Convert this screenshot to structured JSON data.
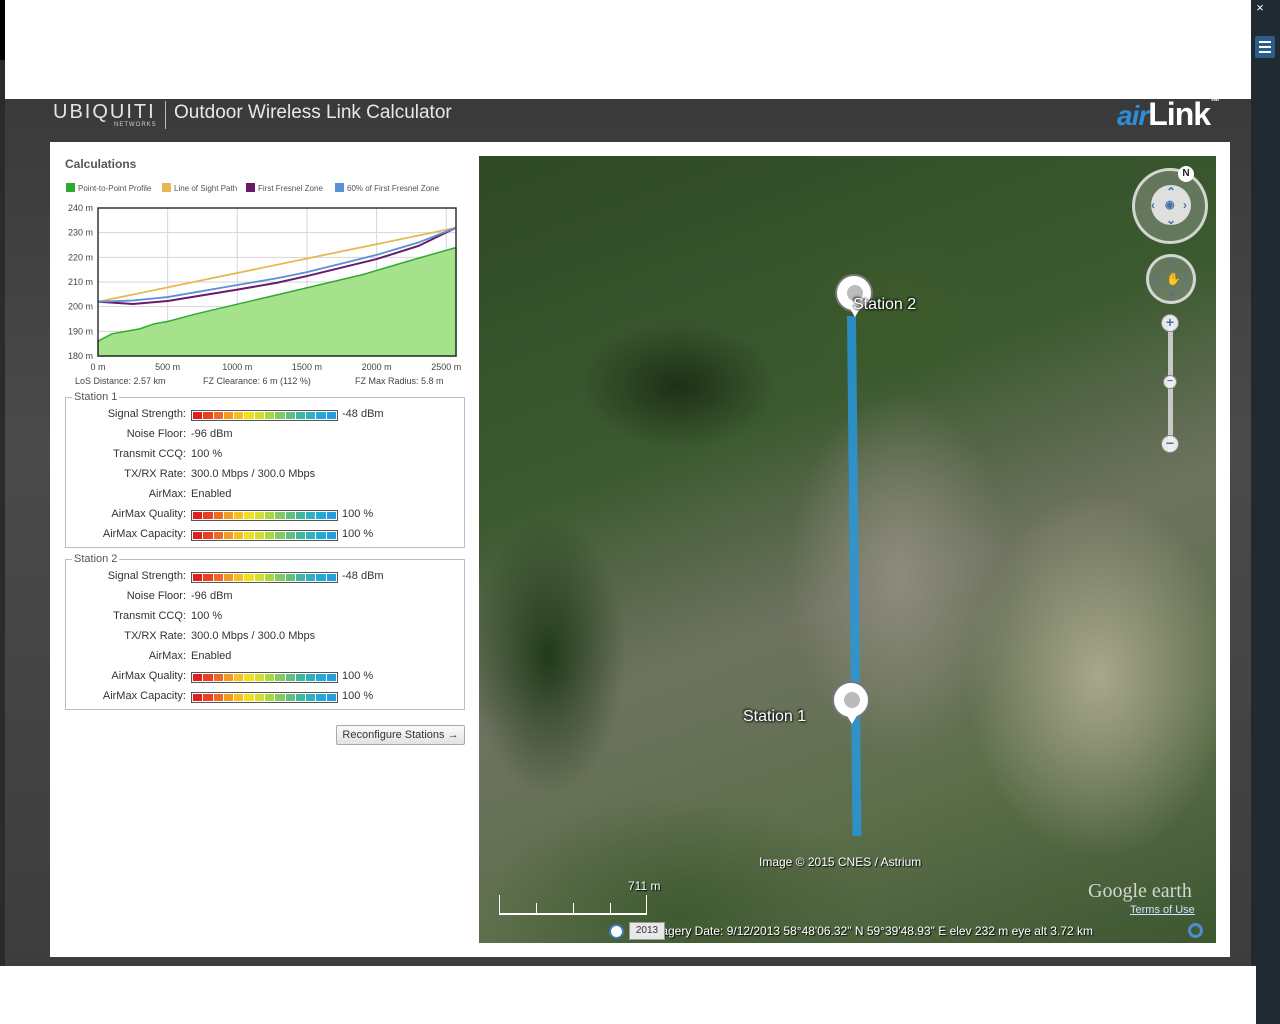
{
  "header": {
    "brand": "UBIQUITI",
    "brand_sub": "NETWORKS",
    "title": "Outdoor Wireless Link Calculator",
    "product_logo_air": "air",
    "product_logo_link": "Link",
    "product_logo_tm": "TM"
  },
  "window": {
    "close_label": "×"
  },
  "calculations": {
    "title": "Calculations",
    "legend": [
      {
        "label": "Point-to-Point Profile",
        "color": "#2eab2e"
      },
      {
        "label": "Line of Sight Path",
        "color": "#e6b84f"
      },
      {
        "label": "First Fresnel Zone",
        "color": "#6b1a6b"
      },
      {
        "label": "60% of First Fresnel Zone",
        "color": "#5b8fd6"
      }
    ],
    "summary": {
      "los_distance": "LoS Distance: 2.57 km",
      "fz_clearance": "FZ Clearance: 6 m  (112 %)",
      "fz_max_radius": "FZ Max Radius: 5.8 m"
    }
  },
  "chart_data": {
    "type": "area",
    "title": "",
    "xlabel": "",
    "ylabel": "",
    "xlim": [
      0,
      2570
    ],
    "ylim": [
      180,
      240
    ],
    "x_ticks": [
      "0 m",
      "500 m",
      "1000 m",
      "1500 m",
      "2000 m",
      "2500 m"
    ],
    "x_tick_values": [
      0,
      500,
      1000,
      1500,
      2000,
      2500
    ],
    "y_ticks": [
      "180 m",
      "190 m",
      "200 m",
      "210 m",
      "220 m",
      "230 m",
      "240 m"
    ],
    "y_tick_values": [
      180,
      190,
      200,
      210,
      220,
      230,
      240
    ],
    "grid": true,
    "series": [
      {
        "name": "Point-to-Point Profile",
        "color": "#2eab2e",
        "x": [
          0,
          100,
          200,
          300,
          400,
          500,
          700,
          1000,
          1300,
          1600,
          1900,
          2200,
          2570
        ],
        "y": [
          186,
          189,
          190,
          191,
          193,
          194,
          197,
          201,
          205,
          209,
          213,
          218,
          224
        ]
      },
      {
        "name": "Line of Sight Path",
        "color": "#e6b84f",
        "x": [
          0,
          2570
        ],
        "y": [
          202,
          232
        ]
      },
      {
        "name": "First Fresnel Zone",
        "color": "#6b1a6b",
        "x": [
          0,
          250,
          500,
          1000,
          1285,
          1500,
          2000,
          2300,
          2570
        ],
        "y": [
          202,
          201.1,
          202.3,
          206.9,
          209.7,
          212.4,
          219.3,
          224.6,
          232
        ]
      },
      {
        "name": "60% of First Fresnel Zone",
        "color": "#5b8fd6",
        "x": [
          0,
          250,
          500,
          1000,
          1285,
          1500,
          2000,
          2300,
          2570
        ],
        "y": [
          202,
          202.5,
          203.9,
          208.8,
          211.5,
          214.0,
          221.0,
          226.0,
          232
        ]
      }
    ]
  },
  "stations": [
    {
      "title": "Station 1",
      "signal_strength_label": "Signal Strength:",
      "signal_strength": "-48 dBm",
      "noise_floor_label": "Noise Floor:",
      "noise_floor": "-96 dBm",
      "ccq_label": "Transmit CCQ:",
      "ccq": "100 %",
      "rate_label": "TX/RX Rate:",
      "rate": "300.0 Mbps / 300.0 Mbps",
      "airmax_label": "AirMax:",
      "airmax": "Enabled",
      "airmax_quality_label": "AirMax Quality:",
      "airmax_quality": "100 %",
      "airmax_capacity_label": "AirMax Capacity:",
      "airmax_capacity": "100 %"
    },
    {
      "title": "Station 2",
      "signal_strength_label": "Signal Strength:",
      "signal_strength": "-48 dBm",
      "noise_floor_label": "Noise Floor:",
      "noise_floor": "-96 dBm",
      "ccq_label": "Transmit CCQ:",
      "ccq": "100 %",
      "rate_label": "TX/RX Rate:",
      "rate": "300.0 Mbps / 300.0 Mbps",
      "airmax_label": "AirMax:",
      "airmax": "Enabled",
      "airmax_quality_label": "AirMax Quality:",
      "airmax_quality": "100 %",
      "airmax_capacity_label": "AirMax Capacity:",
      "airmax_capacity": "100 %"
    }
  ],
  "meter_colors": [
    "#e02020",
    "#e84020",
    "#ef6a20",
    "#f39a20",
    "#f5c020",
    "#f0e020",
    "#d0e030",
    "#a8d840",
    "#80cc60",
    "#60c080",
    "#40b8a0",
    "#30b0c0",
    "#28a8d8",
    "#20a0e0"
  ],
  "reconfigure_button": "Reconfigure Stations →",
  "map": {
    "station1_label": "Station 1",
    "station2_label": "Station 2",
    "compass_label": "N",
    "zoom_in": "+",
    "zoom_out": "−",
    "image_credit": "Image © 2015 CNES / Astrium",
    "scale_label": "711 m",
    "date_box": "2013",
    "status": "Imagery Date: 9/12/2013     58°48'06.32\" N   59°39'48.93\" E  elev   232 m       eye alt   3.72 km",
    "google_logo": "Google earth",
    "terms": "Terms of Use"
  }
}
